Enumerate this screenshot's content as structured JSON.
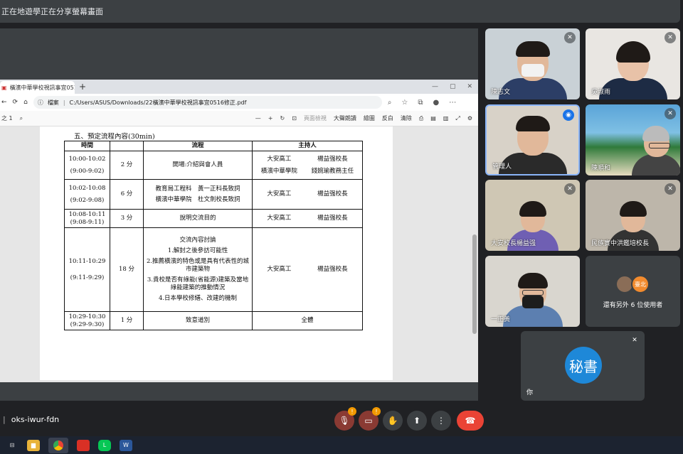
{
  "banner": {
    "text": "正在地遊學正在分享螢幕畫面"
  },
  "browser": {
    "tab_title": "橫濱中華學校視訊事宜0516修",
    "tab_new": "+",
    "address": {
      "site_label": "檔案",
      "url": "C:/Users/ASUS/Downloads/22橫濱中華學校視訊事宜0516修正.pdf"
    },
    "pdf_toolbar": {
      "page_label": "之 1",
      "minus": "—",
      "plus": "+",
      "page_view": "頁面檢視",
      "read_aloud": "大聲朗讀",
      "draw": "繪圖",
      "highlight": "反白",
      "erase": "清除"
    }
  },
  "document": {
    "heading": "五、預定流程內容(30min)",
    "columns": [
      "時間",
      "",
      "流程",
      "主持人"
    ],
    "rows": [
      {
        "time": "10:00-10:02",
        "time_alt": "(9:00-9:02)",
        "duration": "2 分",
        "flow": [
          "開場:介紹與會人員"
        ],
        "hosts": [
          [
            "大安高工",
            "楊益强校長"
          ],
          [
            "橫濱中華學院",
            "錢婉瑜教務主任"
          ]
        ]
      },
      {
        "time": "10:02-10:08",
        "time_alt": "(9:02-9:08)",
        "duration": "6 分",
        "flow": [
          "教育局工程科　黃一正科長致詞",
          "橫濱中華學院　杜文劍校長致詞"
        ],
        "hosts": [
          [
            "大安高工",
            "楊益强校長"
          ]
        ]
      },
      {
        "time": "10:08-10:11",
        "time_alt": "(9:08-9:11)",
        "duration": "3 分",
        "flow": [
          "說明交流目的"
        ],
        "hosts": [
          [
            "大安高工",
            "楊益强校長"
          ]
        ]
      },
      {
        "time": "10:11-10:29",
        "time_alt": "(9:11-9:29)",
        "duration": "18 分",
        "flow_title": "交流內容討論",
        "flow": [
          "1.解封之後參訪可能性",
          "2.推薦橫濱的特色或是具有代表性的城市建築物",
          "3.貴校是否有綠能(省能源)建築及當地綠能建築的推動情況",
          "4.日本學校修繕、改建的機制"
        ],
        "hosts": [
          [
            "大安高工",
            "楊益强校長"
          ]
        ]
      },
      {
        "time": "10:29-10:30",
        "time_alt": "(9:29-9:30)",
        "duration": "1 分",
        "flow": [
          "致意道別"
        ],
        "hosts_all": "全體"
      }
    ]
  },
  "participants": [
    {
      "name": "陳志文",
      "mic": "muted"
    },
    {
      "name": "吳淑雨",
      "mic": "muted"
    },
    {
      "name": "管理人",
      "mic": "speaking"
    },
    {
      "name": "陳順和",
      "mic": "muted"
    },
    {
      "name": "大安校長楊益强",
      "mic": "muted"
    },
    {
      "name": "民族實中洪鑑培校長",
      "mic": "muted"
    },
    {
      "name": "一正黃",
      "mic": "none"
    }
  ],
  "others": {
    "avatar_text": "臺北",
    "text": "還有另外 6 位使用者"
  },
  "self": {
    "initials": "秘書",
    "name": "你"
  },
  "meeting": {
    "code": "oks-iwur-fdn",
    "badge_mic": "!",
    "badge_cam": "!"
  },
  "colors": {
    "end_call": "#ea4335",
    "speaking": "#1a73e8",
    "self_avatar": "#1e88d8"
  }
}
